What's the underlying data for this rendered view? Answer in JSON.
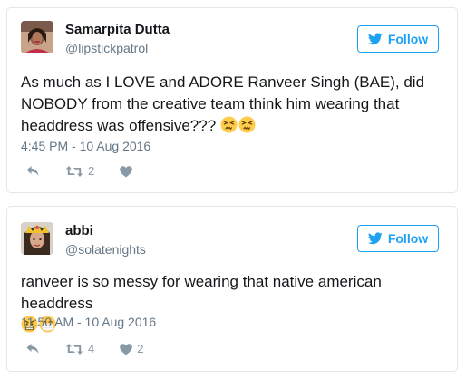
{
  "colors": {
    "accent": "#1da1f2",
    "secondary_text": "#657786",
    "action_icon": "#8899a6",
    "border": "#e1e8ed"
  },
  "tweets": [
    {
      "author": {
        "name": "Samarpita Dutta",
        "handle": "@lipstickpatrol"
      },
      "follow_label": "Follow",
      "text": "As much as I LOVE and ADORE Ranveer Singh (BAE), did NOBODY from the creative team think him wearing that headdress was offensive???",
      "emojis": [
        "persevering-face-emoji",
        "persevering-face-emoji"
      ],
      "timestamp": "4:45 PM - 10 Aug 2016",
      "retweets": "2",
      "likes": ""
    },
    {
      "author": {
        "name": "abbi",
        "handle": "@solatenights"
      },
      "follow_label": "Follow",
      "text": "ranveer is so messy for wearing that native american headdress",
      "emojis": [
        "angry-face-emoji",
        "face-with-medical-mask-emoji"
      ],
      "timestamp": "11:50 AM - 10 Aug 2016",
      "retweets": "4",
      "likes": "2"
    }
  ]
}
